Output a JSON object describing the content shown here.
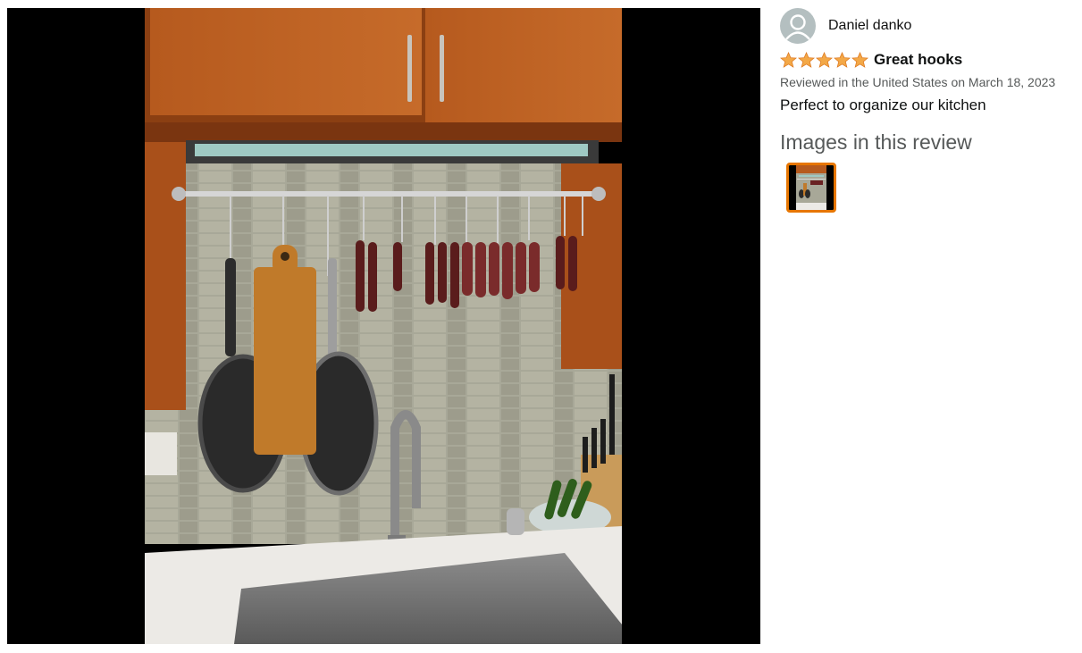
{
  "review": {
    "author": "Daniel danko",
    "rating": 5,
    "title": "Great hooks",
    "date": "Reviewed in the United States on March 18, 2023",
    "body": "Perfect to organize our kitchen",
    "images_heading": "Images in this review"
  },
  "icons": {
    "avatar": "user-silhouette-icon",
    "star": "star-icon"
  },
  "colors": {
    "star": "#f3a847",
    "thumb_border": "#e77600",
    "viewer_bg": "#000000"
  }
}
